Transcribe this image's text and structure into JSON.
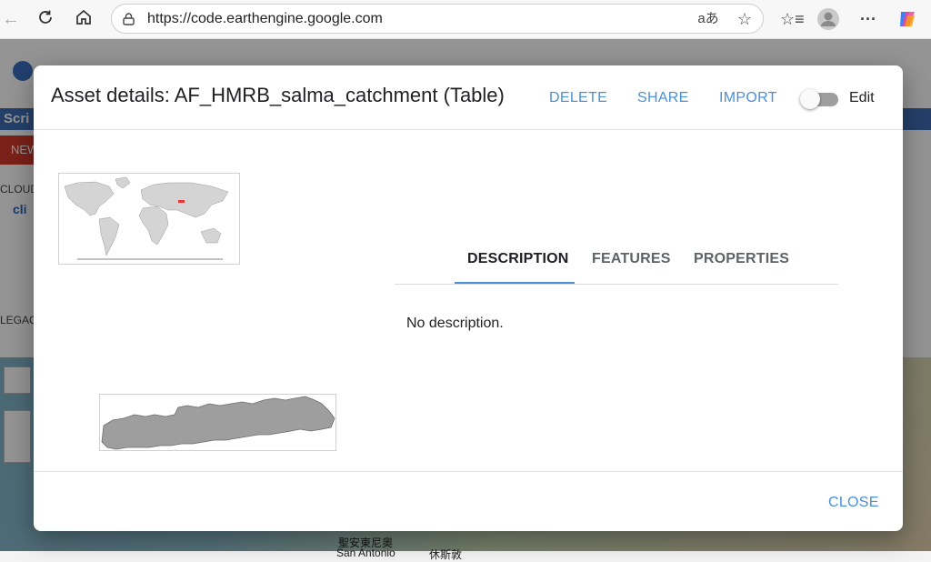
{
  "browser": {
    "url": "https://code.earthengine.google.com",
    "icons": [
      "back-icon",
      "refresh-icon",
      "home-icon",
      "lock-icon",
      "read-aloud-icon",
      "favorite-star-icon",
      "favorites-list-icon",
      "profile-avatar-icon",
      "more-icon",
      "copilot-icon"
    ]
  },
  "background": {
    "scripts_tab": "Scri",
    "new_button": "NEW",
    "cloud_label": "CLOUD",
    "cli_label": "cli",
    "legacy_label": "LEGAC",
    "map_labels": [
      "聖安東尼奧",
      "San Antonio",
      "休斯敦"
    ]
  },
  "dialog": {
    "title": "Asset details: AF_HMRB_salma_catchment (Table)",
    "actions": {
      "delete": "DELETE",
      "share": "SHARE",
      "import": "IMPORT"
    },
    "edit_label": "Edit",
    "edit_enabled": false,
    "tabs": [
      {
        "label": "DESCRIPTION",
        "active": true
      },
      {
        "label": "FEATURES",
        "active": false
      },
      {
        "label": "PROPERTIES",
        "active": false
      }
    ],
    "description": "No description.",
    "help_symbol": "?",
    "close_label": "CLOSE"
  },
  "colors": {
    "accent": "#4a8fd8",
    "footprint_highlight": "#e53935",
    "shape_fill": "#9e9e9e"
  }
}
